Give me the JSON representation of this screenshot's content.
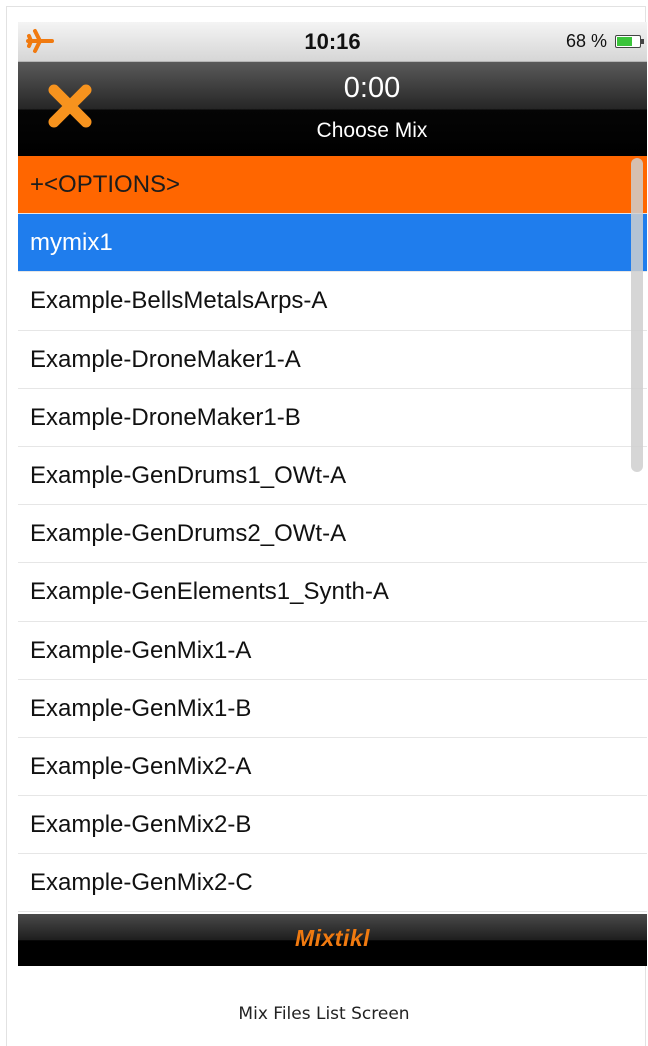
{
  "status_bar": {
    "time": "10:16",
    "battery_percent_label": "68 %",
    "battery_level": 0.68,
    "airplane_icon": "airplane-icon"
  },
  "nav": {
    "timer": "0:00",
    "title": "Choose Mix",
    "close_icon": "close-icon"
  },
  "list": {
    "items": [
      {
        "label": "+<OPTIONS>",
        "state": "options"
      },
      {
        "label": "mymix1",
        "state": "selected"
      },
      {
        "label": "Example-BellsMetalsArps-A",
        "state": "normal"
      },
      {
        "label": "Example-DroneMaker1-A",
        "state": "normal"
      },
      {
        "label": "Example-DroneMaker1-B",
        "state": "normal"
      },
      {
        "label": "Example-GenDrums1_OWt-A",
        "state": "normal"
      },
      {
        "label": "Example-GenDrums2_OWt-A",
        "state": "normal"
      },
      {
        "label": "Example-GenElements1_Synth-A",
        "state": "normal"
      },
      {
        "label": "Example-GenMix1-A",
        "state": "normal"
      },
      {
        "label": "Example-GenMix1-B",
        "state": "normal"
      },
      {
        "label": "Example-GenMix2-A",
        "state": "normal"
      },
      {
        "label": "Example-GenMix2-B",
        "state": "normal"
      },
      {
        "label": "Example-GenMix2-C",
        "state": "normal"
      }
    ]
  },
  "footer": {
    "brand": "Mixtikl"
  },
  "caption": "Mix Files List Screen",
  "colors": {
    "options_row": "#ff6600",
    "selected_row": "#1f7ded",
    "accent_orange": "#f07a10",
    "battery_green": "#3bc43b"
  }
}
